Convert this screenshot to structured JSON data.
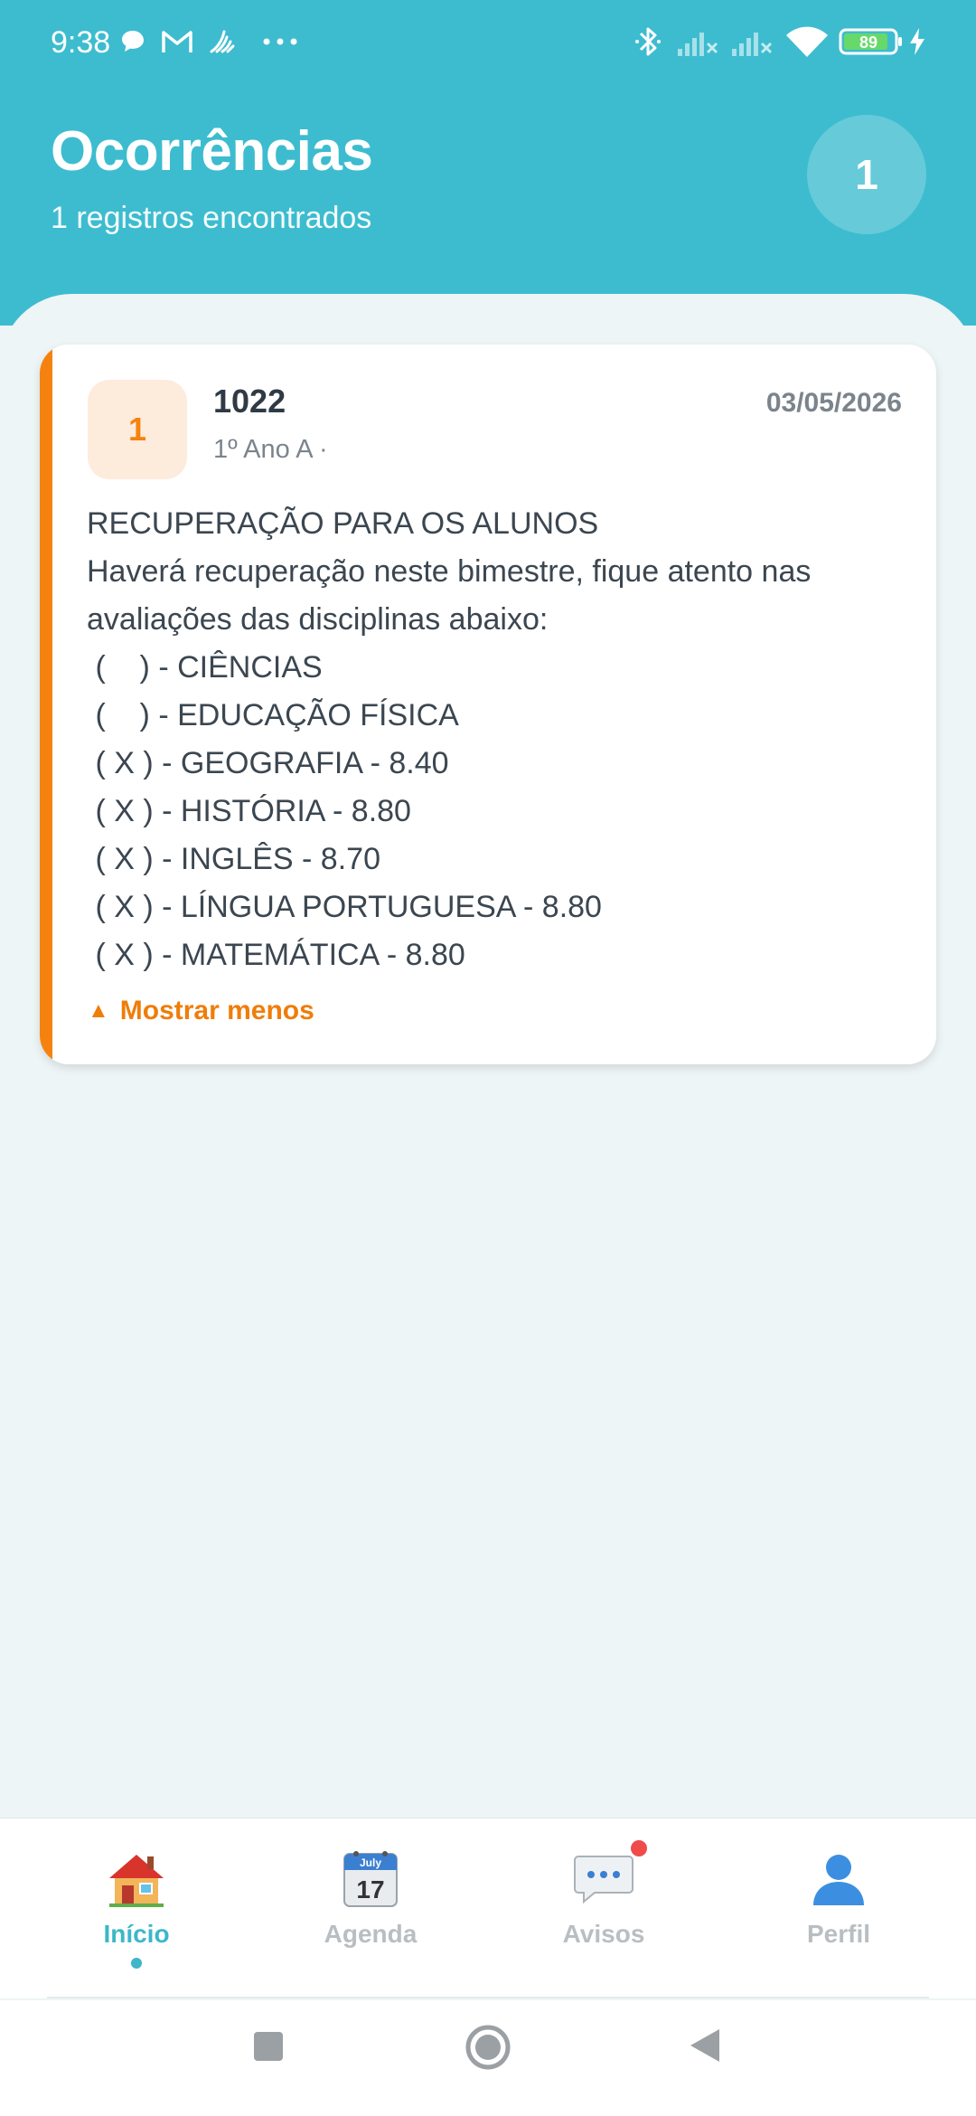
{
  "status_bar": {
    "time": "9:38",
    "battery": "89",
    "icons": [
      "chat-bubble-icon",
      "gmail-icon",
      "signal-app-icon",
      "more-dots-icon",
      "bluetooth-icon",
      "signal-off-icon",
      "signal-off-icon",
      "wifi-icon",
      "battery-icon",
      "charging-icon"
    ]
  },
  "header": {
    "title": "Ocorrências",
    "subtitle": "1 registros encontrados",
    "count": "1"
  },
  "card": {
    "badge": "1",
    "id": "1022",
    "class_info": "1º Ano A ·",
    "date": "03/05/2026",
    "accent_color": "#f5820f",
    "body_title": "RECUPERAÇÃO PARA OS ALUNOS",
    "body_intro": "Haverá recuperação neste bimestre, fique atento nas avaliações das disciplinas abaixo:",
    "items": [
      " (    ) - CIÊNCIAS",
      " (    ) - EDUCAÇÃO FÍSICA",
      " ( X ) - GEOGRAFIA - 8.40",
      " ( X ) - HISTÓRIA - 8.80",
      " ( X ) - INGLÊS - 8.70",
      " ( X ) - LÍNGUA PORTUGUESA - 8.80",
      " ( X ) - MATEMÁTICA - 8.80"
    ],
    "toggle_label": "Mostrar menos",
    "toggle_icon": "▲"
  },
  "bottom_nav": {
    "items": [
      {
        "label": "Início",
        "icon": "house-icon",
        "active": true
      },
      {
        "label": "Agenda",
        "icon": "calendar-icon",
        "calendar_month": "July",
        "calendar_day": "17",
        "active": false
      },
      {
        "label": "Avisos",
        "icon": "speech-bubble-icon",
        "active": false
      },
      {
        "label": "Perfil",
        "icon": "person-icon",
        "active": false
      }
    ]
  },
  "colors": {
    "header_bg": "#3dbccf",
    "accent_orange": "#f5820f",
    "active_tab": "#3db7c9"
  }
}
